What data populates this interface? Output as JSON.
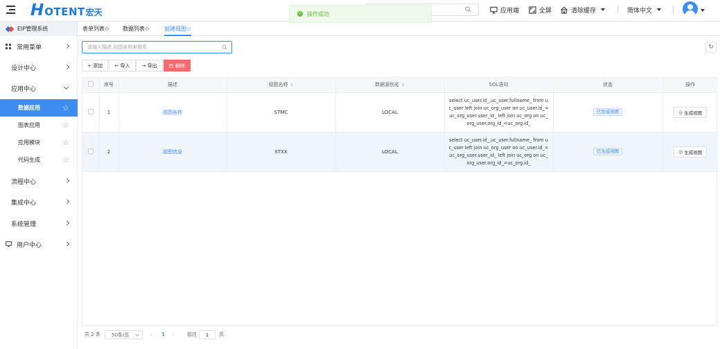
{
  "header": {
    "logo_h": "H",
    "logo_rest": "OTENT",
    "logo_cn": "宏天",
    "toast": "操作成功",
    "app_label": "应用端",
    "fullscreen_label": "全屏",
    "clear_cache_label": "清除缓存",
    "language_label": "简体中文"
  },
  "sidebar": {
    "brand": "EIP管理系统",
    "items": [
      {
        "label": "常用菜单"
      },
      {
        "label": "设计中心"
      },
      {
        "label": "应用中心"
      },
      {
        "label": "流程中心"
      },
      {
        "label": "集成中心"
      },
      {
        "label": "系统管理"
      },
      {
        "label": "用户中心"
      }
    ],
    "sub_items": [
      {
        "label": "数据应用"
      },
      {
        "label": "图表应用"
      },
      {
        "label": "应用模块"
      },
      {
        "label": "代码生成"
      }
    ]
  },
  "tabs": [
    {
      "label": "表单列表✩"
    },
    {
      "label": "数据列表✩"
    },
    {
      "label": "创建视图✩"
    }
  ],
  "filter": {
    "placeholder": "请输入描述,视图名称来搜索"
  },
  "toolbar": {
    "add_label": "+ 添加",
    "import_label": "← 导入",
    "export_label": "→ 导出",
    "delete_label": "删除"
  },
  "table": {
    "headers": [
      "序号",
      "描述",
      "视图名称",
      "数据源别名",
      "SQL语句",
      "状态",
      "操作"
    ],
    "rows": [
      {
        "index": "1",
        "desc": "视图名称",
        "view_name": "STMC",
        "datasource": "LOCAL",
        "sql": "select uc_user.id_,uc_user.fullname_ from uc_user left join uc_org_user on uc_user.id_=uc_org_user.user_id_ left join uc_org on uc_org_user.org_id_=uc_org.id_",
        "status": "已生成视图",
        "action": "生成视图"
      },
      {
        "index": "2",
        "desc": "视图信息",
        "view_name": "STXX",
        "datasource": "LOCAL",
        "sql": "select uc_user.id_,uc_user.fullname_ from uc_user left join uc_org_user on uc_user.id_=uc_org_user.user_id_ left join uc_org on uc_org_user.org_id_=uc_org.id_",
        "status": "已生成视图",
        "action": "生成视图"
      }
    ]
  },
  "pagination": {
    "total": "共 2 条",
    "page_size": "50条/页",
    "current_page": "1",
    "goto_label": "前往",
    "goto_value": "1",
    "page_suffix": "页"
  },
  "colors": {
    "brand": "#1e78d7",
    "accent": "#3d8cf0",
    "danger": "#f56c6c",
    "success": "#67c23a"
  }
}
